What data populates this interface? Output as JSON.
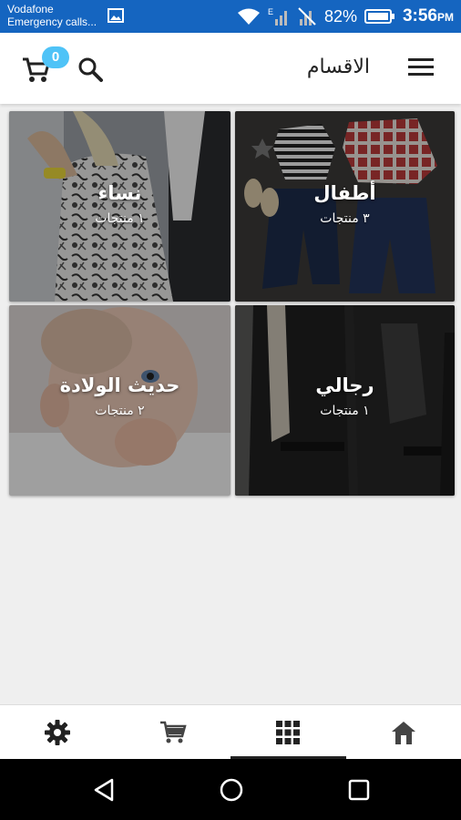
{
  "status_bar": {
    "carrier_line1": "Vodafone",
    "carrier_line2": "Emergency calls...",
    "battery": "82%",
    "time": "3:56",
    "time_suffix": "PM"
  },
  "app_bar": {
    "title": "الاقسام",
    "cart_count": "0",
    "accent_color": "#4fc3f7"
  },
  "categories": [
    {
      "name": "نساء",
      "count": "١ منتجات",
      "image": "woman-in-patterned-dress"
    },
    {
      "name": "أطفال",
      "count": "٣ منتجات",
      "image": "kids-clothing-flat-lay"
    },
    {
      "name": "حديث الولادة",
      "count": "٢ منتجات",
      "image": "baby-portrait"
    },
    {
      "name": "رجالي",
      "count": "١ منتجات",
      "image": "men-in-suits"
    }
  ],
  "bottom_nav": {
    "items": [
      "settings-icon",
      "cart-icon",
      "grid-icon",
      "home-icon"
    ],
    "active": "grid-icon"
  },
  "system_nav": [
    "back-icon",
    "home-circle-icon",
    "recents-icon"
  ]
}
